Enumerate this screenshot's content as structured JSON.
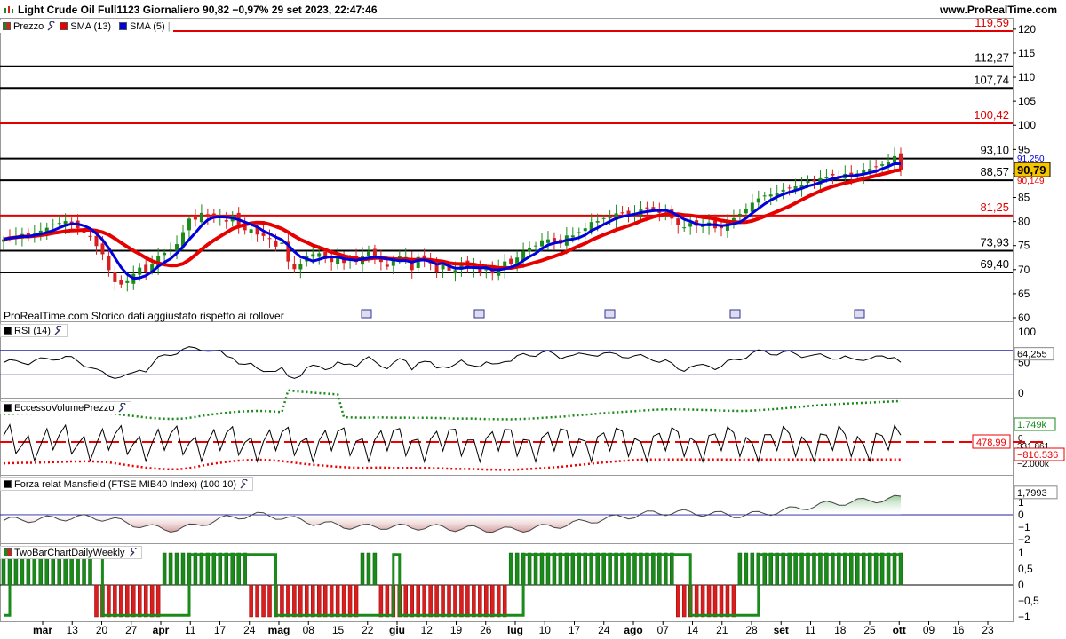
{
  "header": {
    "title": "Light Crude Oil Full1123 Giornaliero 90,82 −0,97% 29 set 2023, 22:47:46",
    "site": "www.ProRealTime.com"
  },
  "legend": {
    "price": "Prezzo",
    "sma13": "SMA (13)",
    "sma5": "SMA (5)"
  },
  "footnote": "ProRealTime.com  Storico dati aggiustato rispetto ai rollover",
  "panels": {
    "rsi": {
      "label": "RSI (14)",
      "value": "64,255",
      "ticks": [
        "100",
        "50",
        "0"
      ]
    },
    "volume": {
      "label": "EccessoVolumePrezzo",
      "upper": "1.749k",
      "zero": "0",
      "mid": "331.861",
      "lower": "−816.536",
      "lowtick": "−2.000k",
      "ref": "478,99"
    },
    "mansfield": {
      "label": "Forza relat Mansfield (FTSE MIB40 Index) (100 10)",
      "value": "1,7993",
      "ticks": [
        "2",
        "1",
        "0",
        "−1",
        "−2"
      ]
    },
    "twobar": {
      "label": "TwoBarChartDailyWeekly",
      "ticks": [
        "1",
        "0,5",
        "0",
        "−0,5",
        "−1"
      ]
    }
  },
  "colors": {
    "up": "#1a8a1a",
    "down": "#d81e1e",
    "sma13": "#e60000",
    "sma5": "#0000dd",
    "level_red": "#e00000",
    "level_black": "#000000"
  },
  "chart_data": {
    "type": "candlestick",
    "title": "Light Crude Oil Full1123 Giornaliero",
    "ylim": [
      60,
      122
    ],
    "yticks": [
      "120",
      "115",
      "110",
      "105",
      "100",
      "95",
      "90",
      "85",
      "80",
      "75",
      "70",
      "65",
      "60"
    ],
    "last_price": "90,79",
    "sma5_tag": "91,250",
    "sma13_tag": "90,149",
    "levels": [
      {
        "value": 119.59,
        "label": "119,59",
        "color": "red"
      },
      {
        "value": 112.27,
        "label": "112,27",
        "color": "black"
      },
      {
        "value": 107.74,
        "label": "107,74",
        "color": "black"
      },
      {
        "value": 100.42,
        "label": "100,42",
        "color": "red"
      },
      {
        "value": 93.1,
        "label": "93,10",
        "color": "black"
      },
      {
        "value": 88.57,
        "label": "88,57",
        "color": "black"
      },
      {
        "value": 81.25,
        "label": "81,25",
        "color": "red"
      },
      {
        "value": 73.93,
        "label": "73,93",
        "color": "black"
      },
      {
        "value": 69.4,
        "label": "69,40",
        "color": "black"
      }
    ],
    "x_labels": [
      "mar",
      "13",
      "20",
      "27",
      "apr",
      "11",
      "17",
      "24",
      "mag",
      "08",
      "15",
      "22",
      "giu",
      "12",
      "19",
      "26",
      "lug",
      "10",
      "17",
      "24",
      "ago",
      "07",
      "14",
      "21",
      "28",
      "set",
      "11",
      "18",
      "25",
      "ott",
      "09",
      "16",
      "23"
    ],
    "bold_labels": [
      "mar",
      "apr",
      "mag",
      "giu",
      "lug",
      "ago",
      "set",
      "ott"
    ],
    "close": [
      76.3,
      76.8,
      77.0,
      77.4,
      76.9,
      77.6,
      78.1,
      78.7,
      79.4,
      79.7,
      80.1,
      79.6,
      78.6,
      77.6,
      76.8,
      74.9,
      73.2,
      69.9,
      67.4,
      66.9,
      67.6,
      69.1,
      70.4,
      69.6,
      71.2,
      72.9,
      73.5,
      74.2,
      75.3,
      77.8,
      80.6,
      80.4,
      81.8,
      81.1,
      80.6,
      80.9,
      80.0,
      81.2,
      79.2,
      78.2,
      78.4,
      77.3,
      77.0,
      76.4,
      74.8,
      75.6,
      71.7,
      70.1,
      71.1,
      72.8,
      73.2,
      73.4,
      72.2,
      71.6,
      72.7,
      71.4,
      72.5,
      71.6,
      72.9,
      73.7,
      72.4,
      71.6,
      70.6,
      71.9,
      72.8,
      72.6,
      69.9,
      72.6,
      72.2,
      71.3,
      69.5,
      70.9,
      69.8,
      69.9,
      71.3,
      70.4,
      70.7,
      69.5,
      70.1,
      69.2,
      70.3,
      71.7,
      71.1,
      72.5,
      73.8,
      74.4,
      75.0,
      76.1,
      76.3,
      75.8,
      75.4,
      77.1,
      77.1,
      77.8,
      78.6,
      79.9,
      80.1,
      80.7,
      80.9,
      81.7,
      81.7,
      81.6,
      81.8,
      82.5,
      82.7,
      82.7,
      81.8,
      81.9,
      80.6,
      79.2,
      78.8,
      79.7,
      79.1,
      79.5,
      79.8,
      78.6,
      78.6,
      79.9,
      80.7,
      81.6,
      82.6,
      83.9,
      84.8,
      85.4,
      85.6,
      85.9,
      86.6,
      87.0,
      87.3,
      87.5,
      88.4,
      88.3,
      89.0,
      89.3,
      89.6,
      89.5,
      89.9,
      89.2,
      90.0,
      90.7,
      91.0,
      91.3,
      91.9,
      92.4,
      93.6,
      90.8
    ],
    "rsi_last": 64.255,
    "mansfield_last": 1.7993
  }
}
